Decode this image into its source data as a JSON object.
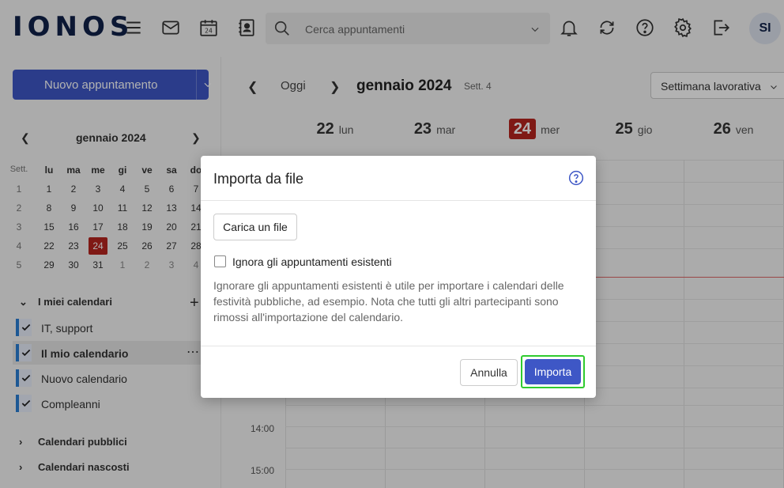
{
  "topbar": {
    "logo": "IONOS",
    "search_placeholder": "Cerca appuntamenti",
    "calendar_icon_day": "24",
    "avatar_initials": "SI"
  },
  "sidebar": {
    "new_button_label": "Nuovo appuntamento",
    "mini_calendar": {
      "title": "gennaio 2024",
      "week_header": "Sett.",
      "day_headers": [
        "lu",
        "ma",
        "me",
        "gi",
        "ve",
        "sa",
        "do"
      ],
      "rows": [
        {
          "week": "1",
          "days": [
            "1",
            "2",
            "3",
            "4",
            "5",
            "6",
            "7"
          ]
        },
        {
          "week": "2",
          "days": [
            "8",
            "9",
            "10",
            "11",
            "12",
            "13",
            "14"
          ]
        },
        {
          "week": "3",
          "days": [
            "15",
            "16",
            "17",
            "18",
            "19",
            "20",
            "21"
          ]
        },
        {
          "week": "4",
          "days": [
            "22",
            "23",
            "24",
            "25",
            "26",
            "27",
            "28"
          ]
        },
        {
          "week": "5",
          "days": [
            "29",
            "30",
            "31",
            "1",
            "2",
            "3",
            "4"
          ]
        }
      ],
      "today": "24"
    },
    "my_calendars_label": "I miei calendari",
    "calendars": [
      {
        "label": "IT, support"
      },
      {
        "label": "Il mio calendario"
      },
      {
        "label": "Nuovo calendario"
      },
      {
        "label": "Compleanni"
      }
    ],
    "public_calendars_label": "Calendari pubblici",
    "hidden_calendars_label": "Calendari nascosti"
  },
  "main": {
    "today_label": "Oggi",
    "month_label": "gennaio 2024",
    "week_label": "Sett. 4",
    "view_label": "Settimana lavorativa",
    "days": [
      {
        "num": "22",
        "name": "lun"
      },
      {
        "num": "23",
        "name": "mar"
      },
      {
        "num": "24",
        "name": "mer"
      },
      {
        "num": "25",
        "name": "gio"
      },
      {
        "num": "26",
        "name": "ven"
      }
    ],
    "times": [
      "14:00",
      "15:00"
    ]
  },
  "dialog": {
    "title": "Importa da file",
    "upload_label": "Carica un file",
    "checkbox_label": "Ignora gli appuntamenti esistenti",
    "help_text": "Ignorare gli appuntamenti esistenti è utile per importare i calendari delle festività pubbliche, ad esempio. Nota che tutti gli altri partecipanti sono rimossi all'importazione del calendario.",
    "cancel_label": "Annulla",
    "import_label": "Importa"
  },
  "colors": {
    "brand": "#11224a",
    "primary_button": "#3e57c6",
    "today": "#b7241f",
    "highlight_border": "#2fcb2f"
  }
}
